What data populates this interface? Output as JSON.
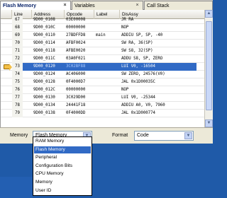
{
  "tabs": [
    {
      "label": "Flash Memory",
      "active": true
    },
    {
      "label": "Variables",
      "active": false
    },
    {
      "label": "Call Stack",
      "active": false
    }
  ],
  "close_glyph": "×",
  "columns": [
    "",
    "Line",
    "Address",
    "Opcode",
    "Label",
    "DisAssy"
  ],
  "rows": [
    {
      "line": "67",
      "address": "9D00_0108",
      "opcode": "03E00008",
      "label": "",
      "disassy": "JR RA"
    },
    {
      "line": "68",
      "address": "9D00_010C",
      "opcode": "00000000",
      "label": "",
      "disassy": "NOP"
    },
    {
      "line": "69",
      "address": "9D00_0110",
      "opcode": "27BDFFD8",
      "label": "main",
      "disassy": "ADDIU SP, SP, -40"
    },
    {
      "line": "70",
      "address": "9D00_0114",
      "opcode": "AFBF0024",
      "label": "",
      "disassy": "SW RA, 36(SP)"
    },
    {
      "line": "71",
      "address": "9D00_0118",
      "opcode": "AFBE0020",
      "label": "",
      "disassy": "SW S8, 32(SP)"
    },
    {
      "line": "72",
      "address": "9D00_011C",
      "opcode": "03A0F021",
      "label": "",
      "disassy": "ADDU S8, SP, ZERO"
    },
    {
      "line": "73",
      "address": "9D00_0120",
      "opcode": "3C02BF88",
      "label": "",
      "disassy": "LUI V0, -16504",
      "selected": true
    },
    {
      "line": "74",
      "address": "9D00_0124",
      "opcode": "AC406000",
      "label": "",
      "disassy": "SW ZERO, 24576(V0)"
    },
    {
      "line": "75",
      "address": "9D00_0128",
      "opcode": "0F4000D7",
      "label": "",
      "disassy": "JAL 0x1D00035C"
    },
    {
      "line": "76",
      "address": "9D00_012C",
      "opcode": "00000000",
      "label": "",
      "disassy": "NOP"
    },
    {
      "line": "77",
      "address": "9D00_0130",
      "opcode": "3C029D00",
      "label": "",
      "disassy": "LUI V0, -25344"
    },
    {
      "line": "78",
      "address": "9D00_0134",
      "opcode": "24441F18",
      "label": "",
      "disassy": "ADDIU A0, V0, 7960"
    },
    {
      "line": "79",
      "address": "9D00_0138",
      "opcode": "0F4000DD",
      "label": "",
      "disassy": "JAL 0x1D000774"
    }
  ],
  "bottom": {
    "memory_label": "Memory",
    "memory_value": "Flash Memory",
    "format_label": "Format",
    "format_value": "Code",
    "dropdown_glyph": "▼"
  },
  "memory_options": [
    {
      "label": "RAM Memory"
    },
    {
      "label": "Flash Memory",
      "highlighted": true
    },
    {
      "label": "Peripheral"
    },
    {
      "label": "Configuration Bits"
    },
    {
      "label": "CPU Memory"
    },
    {
      "label": "Memory"
    },
    {
      "label": "User ID"
    }
  ],
  "scroll": {
    "up": "▲",
    "down": "▼"
  },
  "colors": {
    "selection": "#316ac5",
    "desktop": "#1f5aa8"
  }
}
